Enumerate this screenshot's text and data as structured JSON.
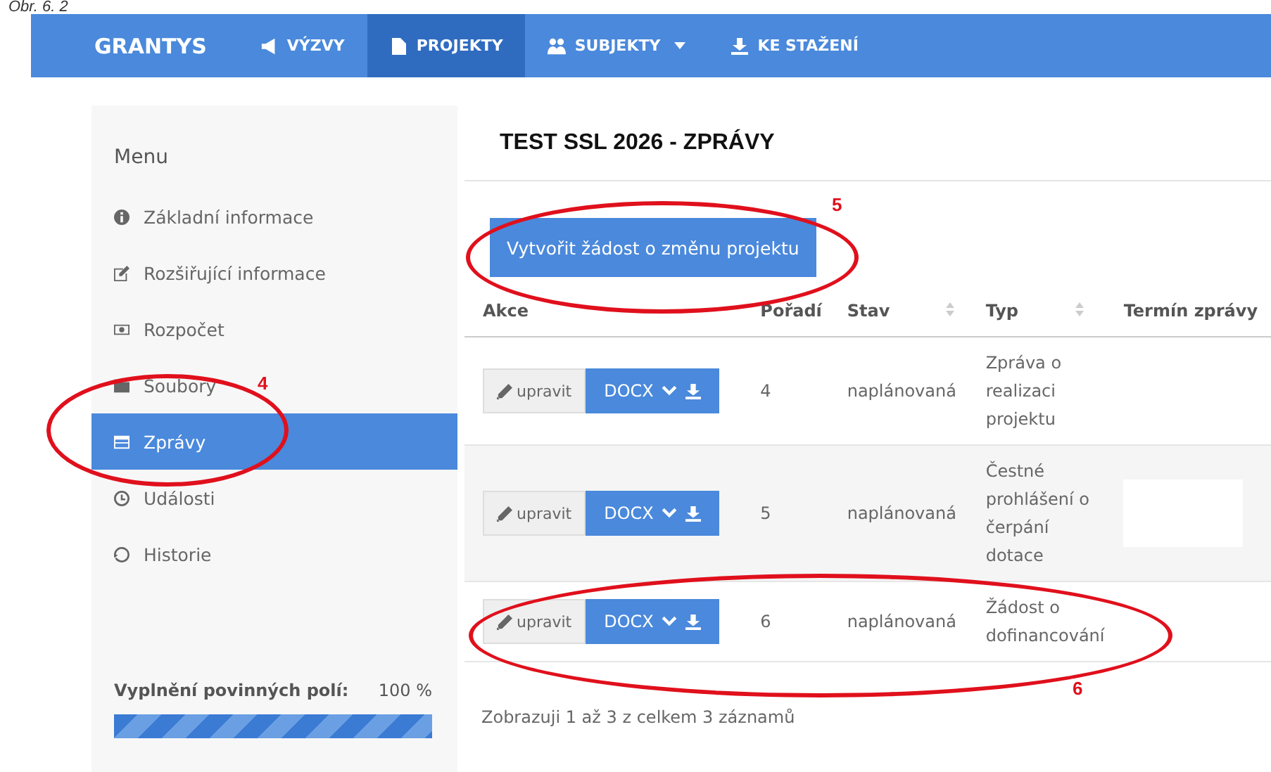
{
  "caption": "Obr. 6. 2",
  "navbar": {
    "brand": "GRANTYS",
    "items": [
      {
        "label": "VÝZVY",
        "dropdown": false,
        "selected": false
      },
      {
        "label": "PROJEKTY",
        "dropdown": false,
        "selected": true
      },
      {
        "label": "SUBJEKTY",
        "dropdown": true,
        "selected": false
      },
      {
        "label": "KE STAŽENÍ",
        "dropdown": false,
        "selected": false
      }
    ]
  },
  "sidebar": {
    "title": "Menu",
    "items": [
      {
        "label": "Základní informace",
        "selected": false
      },
      {
        "label": "Rozšiřující informace",
        "selected": false
      },
      {
        "label": "Rozpočet",
        "selected": false
      },
      {
        "label": "Soubory",
        "selected": false
      },
      {
        "label": "Zprávy",
        "selected": true
      },
      {
        "label": "Události",
        "selected": false
      },
      {
        "label": "Historie",
        "selected": false
      }
    ],
    "progress": {
      "label": "Vyplnění povinných polí:",
      "reading": "100 %",
      "level": 1
    }
  },
  "content": {
    "title": "TEST SSL 2026 - ZPRÁVY",
    "create_button": "Vytvořit žádost o změnu projektu",
    "table": {
      "columns": [
        {
          "label": "Akce",
          "sortable": false
        },
        {
          "label": "Pořadí",
          "sortable": false
        },
        {
          "label": "Stav",
          "sortable": true
        },
        {
          "label": "Typ",
          "sortable": true
        },
        {
          "label": "Termín zprávy",
          "sortable": false
        }
      ],
      "rows": [
        {
          "edit": "upravit",
          "format": "DOCX",
          "order": "4",
          "status": "naplánovaná",
          "type": "Zpráva o realizaci projektu",
          "redacted": false
        },
        {
          "edit": "upravit",
          "format": "DOCX",
          "order": "5",
          "status": "naplánovaná",
          "type": "Čestné prohlášení o čerpání dotace",
          "redacted": true
        },
        {
          "edit": "upravit",
          "format": "DOCX",
          "order": "6",
          "status": "naplánovaná",
          "type": "Žádost o dofinancování",
          "redacted": false
        }
      ]
    },
    "footer": "Zobrazuji 1 až 3 z celkem 3 záznamů"
  },
  "annotations": [
    {
      "number": "4"
    },
    {
      "number": "5"
    },
    {
      "number": "6"
    }
  ]
}
